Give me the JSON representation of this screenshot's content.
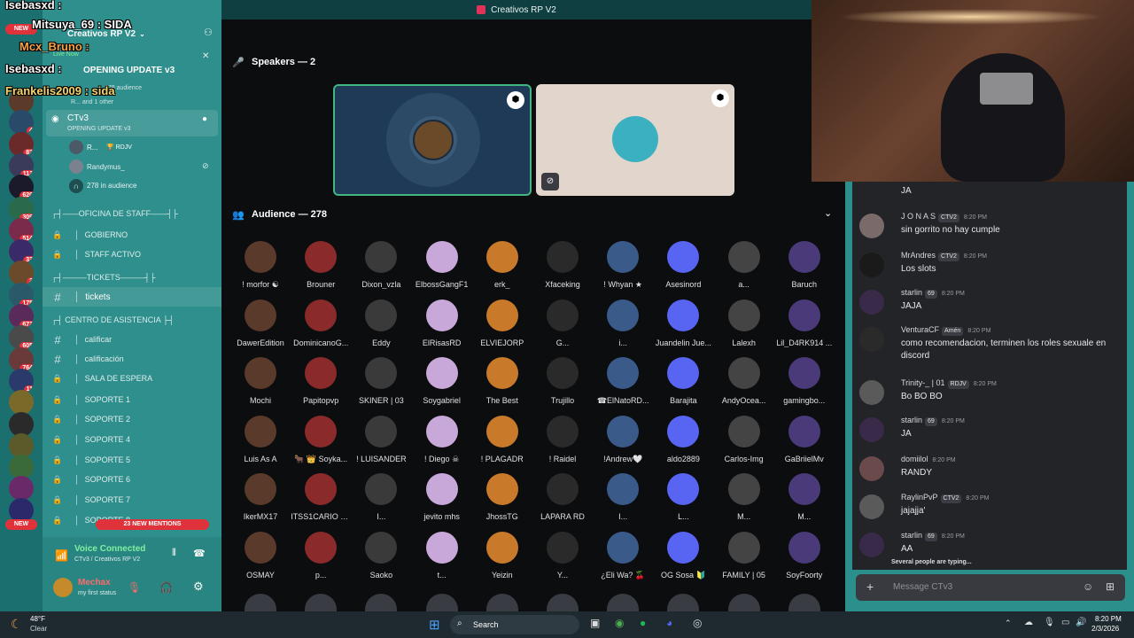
{
  "window_title": "Creativos RP V2",
  "overlay": {
    "lines": [
      "Isebasxd :",
      "Mitsuya_69 : SIDA",
      "Mcx_Bruno :",
      "Isebasxd :",
      "Frankelis2009 : sida"
    ]
  },
  "servers": {
    "new_top": "NEW",
    "new_bottom": "NEW",
    "badges": [
      "4",
      "82",
      "113",
      "620",
      "309",
      "514",
      "33",
      "2",
      "175",
      "672",
      "605",
      "764",
      "11"
    ]
  },
  "sidebar": {
    "server_name": "Creativos RP V2",
    "live_now": "Live Now",
    "event_title": "OPENING UPDATE v3",
    "event_audience": "278 audience",
    "event_sub": "R... and 1 other",
    "stage_channel": "CTv3",
    "stage_topic": "OPENING UPDATE v3",
    "speakers": [
      {
        "name": "R...",
        "tag": "RDJV"
      },
      {
        "name": "Randymus_"
      }
    ],
    "audience_count": "278 in audience",
    "categories": [
      {
        "label": "┌┤——OFICINA DE STAFF——┤├",
        "channels": [
          "GOBIERNO",
          "STAFF ACTIVO"
        ]
      },
      {
        "label": "┌┤———TICKETS———┤├",
        "channels": [
          "tickets"
        ]
      },
      {
        "label": "┌┤ CENTRO DE ASISTENCIA ├┤",
        "channels": [
          "calificar",
          "calificación",
          "SALA DE ESPERA",
          "SOPORTE 1",
          "SOPORTE 2",
          "SOPORTE 4",
          "SOPORTE 5",
          "SOPORTE 6",
          "SOPORTE 7",
          "SOPORTE 8"
        ]
      }
    ],
    "new_mentions": "23 NEW MENTIONS",
    "voice_status": "Voice Connected",
    "voice_channel": "CTv3 / Creativos RP V2",
    "user_name": "Mechax",
    "user_status": "my first status"
  },
  "stage": {
    "speakers_header": "Speakers — 2",
    "audience_header": "Audience — 278",
    "audience": [
      "! morfor ☯",
      "Brouner",
      "Dixon_vzla",
      "ElbossGangF1",
      "erk_",
      "Xfaceking",
      "! Whyan ★",
      "Asesinord",
      "a...",
      "Baruch",
      "DawerEdition",
      "DominicanoG...",
      "Eddy",
      "ElRisasRD",
      "ELVIEJORP",
      "G...",
      "i...",
      "Juandelin Jue...",
      "Lalexh",
      "Lil_D4RK914 ...",
      "Mochi",
      "Papitopvp",
      "SKINER | 03",
      "Soygabriel",
      "The Best",
      "Trujillo",
      "☎ElNatoRD...",
      "Barajita",
      "AndyOcea...",
      "gamingbo...",
      "Luis As A",
      "🐂 👑 Soyka...",
      "! LUISANDER",
      "! Diego ☠",
      "! PLAGADR",
      "! Raidel",
      "!Andrew🤍",
      "aldo2889",
      "Carlos-Img",
      "GaBriielMv",
      "IkerMX17",
      "ITSS1CARIO O...",
      "I...",
      "jevito mhs",
      "JhossTG",
      "LAPARA RD",
      "I...",
      "L...",
      "M...",
      "M...",
      "OSMAY",
      "p...",
      "Saoko",
      "t...",
      "Yeizin",
      "Y...",
      "¿Eli Wa? 🍒",
      "OG Sosa 🔰",
      "FAMILY | 05",
      "SoyFoorty"
    ]
  },
  "chat": {
    "messages": [
      {
        "author": "",
        "time": "",
        "text": "JA"
      },
      {
        "author": "J O N A S",
        "tags": [
          "CTV2"
        ],
        "time": "8:20 PM",
        "text": "sin gorrito no hay cumple"
      },
      {
        "author": "MrAndres",
        "tags": [
          "CTV2"
        ],
        "time": "8:20 PM",
        "text": "Los slots"
      },
      {
        "author": "starlin",
        "tags": [
          "69"
        ],
        "time": "8:20 PM",
        "text": "JAJA"
      },
      {
        "author": "VenturaCF",
        "tags": [
          "Amén"
        ],
        "time": "8:20 PM",
        "text": "como recomendacion, terminen los roles sexuale en discord"
      },
      {
        "author": "Trinity-_ | 01",
        "tags": [
          "RDJV"
        ],
        "time": "8:20 PM",
        "text": "Bo BO BO"
      },
      {
        "author": "starlin",
        "tags": [
          "69"
        ],
        "time": "8:20 PM",
        "text": "JA"
      },
      {
        "author": "domiilol",
        "tags": [],
        "time": "8:20 PM",
        "text": "RANDY"
      },
      {
        "author": "RaylinPvP",
        "tags": [
          "CTV2"
        ],
        "time": "8:20 PM",
        "text": "jajajja'"
      },
      {
        "author": "starlin",
        "tags": [
          "69"
        ],
        "time": "8:20 PM",
        "text": "AA"
      }
    ],
    "typing": "Several people are typing...",
    "input_placeholder": "Message CTv3"
  },
  "taskbar": {
    "temp": "48°F",
    "weather": "Clear",
    "search": "Search",
    "time": "8:20 PM",
    "date": "2/3/2026"
  },
  "colors": {
    "sidebar": "#2f8f8c",
    "server_rail": "#1b6f6e",
    "stage_bg": "#0c0d0f",
    "accent_green": "#43b581",
    "mention_red": "#e0323a"
  }
}
